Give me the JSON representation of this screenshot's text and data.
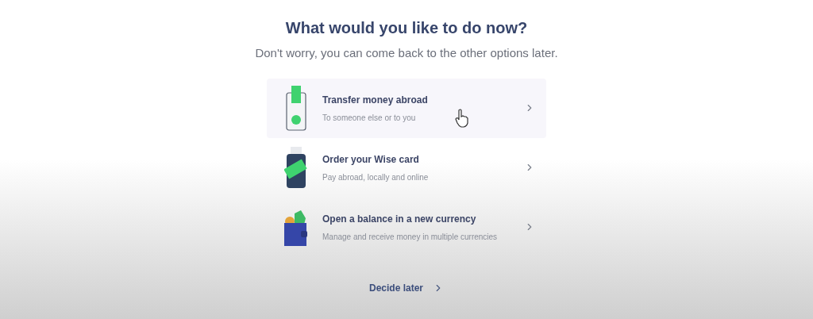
{
  "heading": "What would you like to do now?",
  "subheading": "Don't worry, you can come back to the other options later.",
  "options": [
    {
      "kind": "phone",
      "title": "Transfer money abroad",
      "subtitle": "To someone else or to you",
      "selected": true
    },
    {
      "kind": "card",
      "title": "Order your Wise card",
      "subtitle": "Pay abroad, locally and online",
      "selected": false
    },
    {
      "kind": "wallet",
      "title": "Open a balance in a new currency",
      "subtitle": "Manage and receive money in multiple currencies",
      "selected": false
    }
  ],
  "decide_later": "Decide later"
}
